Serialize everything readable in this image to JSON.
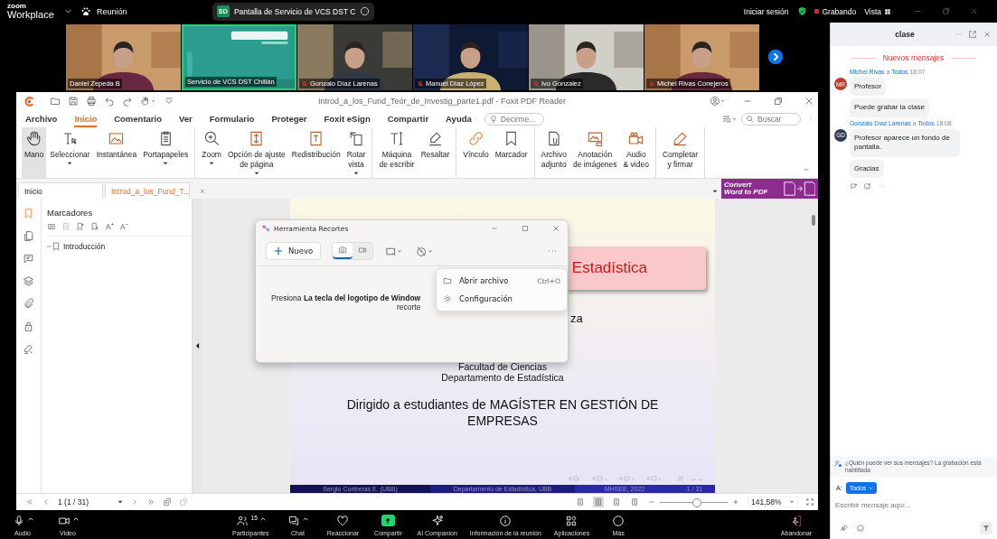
{
  "topbar": {
    "brand_small": "zoom",
    "brand": "Workplace",
    "meeting": "Reunión",
    "share": {
      "badge": "SD",
      "title": "Pantalla de Servicio de VCS DST C"
    },
    "signin": "Iniciar sesión",
    "recording": "Grabando",
    "view": "Vista"
  },
  "participants": [
    {
      "name": "Daniel Zepeda B",
      "muted": false,
      "active": false,
      "kind": "camera"
    },
    {
      "name": "Servicio de VCS DST Chillán",
      "muted": false,
      "active": true,
      "kind": "share"
    },
    {
      "name": "Gonzalo Díaz Larenas",
      "muted": true,
      "active": false,
      "kind": "camera"
    },
    {
      "name": "Manuel Díaz López",
      "muted": true,
      "active": false,
      "kind": "camera"
    },
    {
      "name": "Ivo Gonzalez",
      "muted": true,
      "active": false,
      "kind": "camera"
    },
    {
      "name": "Michel Rivas Conejeros",
      "muted": true,
      "active": false,
      "kind": "camera"
    }
  ],
  "foxit": {
    "title": "Introd_a_los_Fund_Teór_de_Investig_parte1.pdf - Foxit PDF Reader",
    "menu": [
      {
        "label": "Archivo",
        "selected": false
      },
      {
        "label": "Inicio",
        "selected": true
      },
      {
        "label": "Comentario",
        "selected": false
      },
      {
        "label": "Ver",
        "selected": false
      },
      {
        "label": "Formulario",
        "selected": false
      },
      {
        "label": "Proteger",
        "selected": false
      },
      {
        "label": "Foxit eSign",
        "selected": false
      },
      {
        "label": "Compartir",
        "selected": false
      },
      {
        "label": "Ayuda",
        "selected": false
      }
    ],
    "tell_me": {
      "placeholder": "Decirme..."
    },
    "search": {
      "placeholder": "Buscar"
    },
    "ribbon": [
      {
        "items": [
          {
            "label": "Mano",
            "caret": false,
            "selected": true
          },
          {
            "label": "Seleccionar",
            "caret": true,
            "selected": false
          },
          {
            "label": "Instantánea",
            "caret": false,
            "selected": false
          },
          {
            "label": "Portapapeles",
            "caret": true,
            "selected": false
          }
        ]
      },
      {
        "items": [
          {
            "label": "Zoom",
            "caret": true,
            "selected": false
          },
          {
            "label": "Opción de ajuste\nde página",
            "caret": true,
            "selected": false
          },
          {
            "label": "Redistribución",
            "caret": false,
            "selected": false
          },
          {
            "label": "Rotar\nvista",
            "caret": true,
            "selected": false
          }
        ]
      },
      {
        "items": [
          {
            "label": "Máquina\nde escribir",
            "caret": false,
            "selected": false
          },
          {
            "label": "Resaltar",
            "caret": false,
            "selected": false
          }
        ]
      },
      {
        "items": [
          {
            "label": "Vínculo",
            "caret": false,
            "selected": false
          },
          {
            "label": "Marcador",
            "caret": false,
            "selected": false
          }
        ]
      },
      {
        "items": [
          {
            "label": "Archivo\nadjunto",
            "caret": false,
            "selected": false
          },
          {
            "label": "Anotación\nde imágenes",
            "caret": false,
            "selected": false
          },
          {
            "label": "Audio\n& video",
            "caret": false,
            "selected": false
          }
        ]
      },
      {
        "items": [
          {
            "label": "Completar\ny firmar",
            "caret": false,
            "selected": false
          }
        ]
      }
    ],
    "doc_tabs": [
      {
        "label": "Inicio",
        "selected": false
      },
      {
        "label": "Introd_a_los_Fund_T...",
        "selected": true
      }
    ],
    "promo": {
      "line1": "Convert",
      "line2": "Word to PDF"
    },
    "bookmarks": {
      "title": "Marcadores",
      "items": [
        {
          "label": "Introducción"
        }
      ]
    },
    "page": {
      "title": "Estadística",
      "author_tail": "za",
      "faculty": "Facultad de Ciencias",
      "department": "Departamento de Estadística",
      "audience": "Dirigido a estudiantes de MAGÍSTER EN GESTIÓN DE EMPRESAS",
      "footer": [
        "Sergio Contreras E.  (UBB)",
        "Departamento de Estadística, UBB",
        "MHSEE, 2022",
        "1 / 31"
      ]
    },
    "status": {
      "page": "1 (1 / 31)",
      "views": [
        {
          "selected": false
        },
        {
          "selected": true
        },
        {
          "selected": false
        },
        {
          "selected": false
        }
      ],
      "zoom": {
        "level": 0.55,
        "value": "141,58%"
      }
    }
  },
  "snip": {
    "title": "Herramienta Recortes",
    "new": "Nuevo",
    "modes": [
      {
        "selected": true
      },
      {
        "selected": false
      }
    ],
    "line1": "Presiona **La tecla del logotipo de Window**",
    "line2": "recorte",
    "menu": [
      {
        "label": "Abrir archivo",
        "shortcut": "Ctrl+O"
      },
      {
        "label": "Configuración"
      }
    ]
  },
  "toolbar": {
    "left": [
      {
        "label": "Audio",
        "caret": true
      },
      {
        "label": "Video",
        "caret": true
      }
    ],
    "center": [
      {
        "label": "Participantes",
        "caret": true,
        "badge": "15"
      },
      {
        "label": "Chat",
        "caret": true
      },
      {
        "label": "Reaccionar",
        "caret": false
      },
      {
        "label": "Compartir",
        "caret": false
      },
      {
        "label": "AI Companion",
        "caret": false
      },
      {
        "label": "Información de la reunión",
        "caret": false
      },
      {
        "label": "Aplicaciones",
        "caret": false
      },
      {
        "label": "Más",
        "caret": false
      }
    ],
    "right": [
      {
        "label": "Abandonar",
        "caret": false
      }
    ]
  },
  "chat": {
    "title": "clase",
    "divider": "Nuevos mensajes",
    "groups": [
      {
        "initials": "MR",
        "color": "#b8402e",
        "sender": "Michel Rivas",
        "to_word": "a",
        "recipient": "Todos",
        "time": "18:07",
        "messages": [
          "Profesor",
          "Puede grabar la clase"
        ]
      },
      {
        "initials": "GD",
        "color": "#2e3d4f",
        "sender": "Gonzalo Díaz Larenas",
        "to_word": "a",
        "recipient": "Todos",
        "time": "18:08",
        "messages": [
          "Profesor aparece un fondo de pantalla.",
          "Gracias"
        ]
      }
    ],
    "notice": "¿Quién puede ver sus mensajes? La grabación está habilitada",
    "to_label": "A:",
    "recipient": "Todos",
    "placeholder": "Escribir mensaje aquí..."
  }
}
